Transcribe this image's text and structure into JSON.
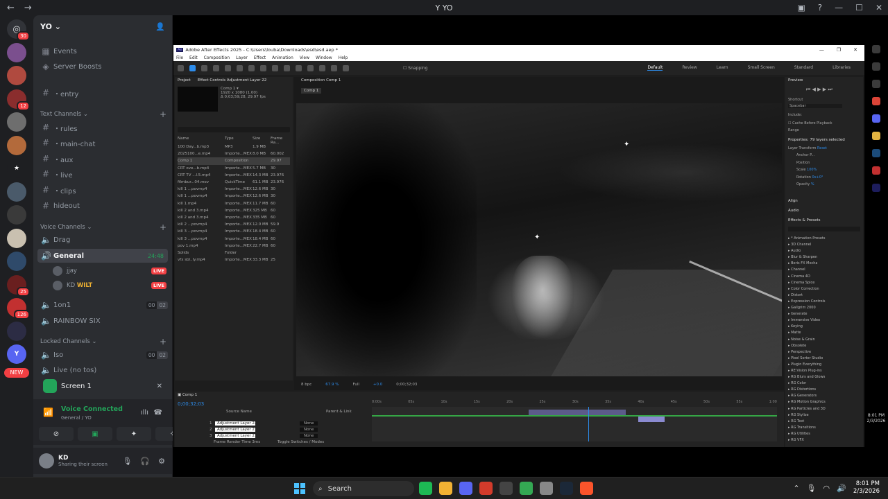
{
  "window": {
    "title": "YO",
    "nav_back": "←",
    "nav_forward": "→",
    "controls": [
      "—",
      "☐",
      "✕"
    ]
  },
  "server_rail": {
    "badges": [
      "30",
      "12",
      "25",
      "126"
    ],
    "server_initial": "Y",
    "new_label": "NEW",
    "home_icon_badge": "30"
  },
  "server": {
    "name": "YO",
    "top_items": [
      {
        "icon": "calendar-icon",
        "label": "Events"
      },
      {
        "icon": "boost-icon",
        "label": "Server Boosts"
      }
    ],
    "entry_channel": "・entry",
    "text_category": "Text Channels",
    "text_channels": [
      "・rules",
      "・main-chat",
      "・aux",
      "・live",
      "・clips",
      "hideout"
    ],
    "voice_category": "Voice Channels",
    "voice_channels": [
      {
        "name": "Drag"
      },
      {
        "name": "General",
        "timer": "24:48",
        "active": true
      },
      {
        "name": "1on1",
        "counts": [
          "00",
          "02"
        ]
      },
      {
        "name": "RAINBOW SIX"
      }
    ],
    "general_members": [
      {
        "name": "jjay",
        "badge": "LIVE"
      },
      {
        "name": "KD",
        "tag": "WILT",
        "badge": "LIVE"
      }
    ],
    "locked_category": "Locked Channels",
    "locked_channels": [
      {
        "name": "Iso",
        "counts": [
          "00",
          "02"
        ]
      },
      {
        "name": "Live (no tos)"
      }
    ]
  },
  "screen_share": {
    "label": "Screen 1"
  },
  "voice_panel": {
    "status": "Voice Connected",
    "location": "General / YO"
  },
  "user_panel": {
    "name": "KD",
    "status": "Sharing their screen"
  },
  "ae": {
    "title": "Adobe After Effects 2025 - C:\\Users\\louba\\Downloads\\esd\\esd.aep *",
    "menu": [
      "File",
      "Edit",
      "Composition",
      "Layer",
      "Effect",
      "Animation",
      "View",
      "Window",
      "Help"
    ],
    "snapping": "Snapping",
    "workspaces": [
      "Default",
      "Review",
      "Learn",
      "Small Screen",
      "Standard",
      "Libraries"
    ],
    "project_tab": "Project",
    "effect_controls_tab": "Effect Controls Adjustment Layer 22",
    "comp_info": [
      "Comp 1 ▾",
      "1920 x 1080 (1.00)",
      "Δ 0;03;59;28, 29.97 fps"
    ],
    "project_headers": [
      "Name",
      "Type",
      "Size",
      "Frame Ra..."
    ],
    "project_rows": [
      [
        "100 Day...b.mp3",
        "MP3",
        "1.9 MB",
        ""
      ],
      [
        "2025100...e.mp4",
        "Importe...MEX",
        "8.0 MB",
        "60.002"
      ],
      [
        "Comp 1",
        "Composition",
        "",
        "29.97"
      ],
      [
        "CRT ove...b.mp4",
        "Importe...MEX",
        "5.7 MB",
        "30"
      ],
      [
        "CRT TV ...l.5.mp4",
        "Importe...MEX",
        "14.3 MB",
        "23.976"
      ],
      [
        "filmbur...04.mov",
        "QuickTime",
        "61.1 MB",
        "23.976"
      ],
      [
        "kill 1 ...povmp4",
        "Importe...MEX",
        "12.6 MB",
        "30"
      ],
      [
        "kill 1 ...povmp4",
        "Importe...MEX",
        "12.6 MB",
        "30"
      ],
      [
        "kill 1.mp4",
        "Importe...MEX",
        "11.7 MB",
        "60"
      ],
      [
        "kill 2 and 3.mp4",
        "Importe...MEX",
        "325 MB",
        "60"
      ],
      [
        "kill 2 and 3.mp4",
        "Importe...MEX",
        "335 MB",
        "60"
      ],
      [
        "kill 2 ...povmp4",
        "Importe...MEX",
        "12.0 MB",
        "59.9"
      ],
      [
        "kill 3 ...povmp4",
        "Importe...MEX",
        "18.4 MB",
        "60"
      ],
      [
        "kill 3 ...povmp4",
        "Importe...MEX",
        "18.4 MB",
        "60"
      ],
      [
        "pov 1.mp4",
        "Importe...MEX",
        "22.7 MB",
        "60"
      ],
      [
        "Solids",
        "Folder",
        "",
        ""
      ],
      [
        "vfx sbl..ly.mp4",
        "Importe...MEX",
        "33.3 MB",
        "25"
      ]
    ],
    "comp_tab": "Composition Comp 1",
    "comp_subtab": "Comp 1",
    "viewer_footer": [
      "67.9 %",
      "Full",
      "+0.0",
      "0;00;32;03",
      "8 bpc"
    ],
    "timeline": {
      "tab": "Comp 1",
      "timecode": "0;00;32;03",
      "columns": [
        "Source Name",
        "Parent & Link"
      ],
      "layers": [
        {
          "idx": "1",
          "name": "Adjustment Layer 22",
          "parent": "None"
        },
        {
          "idx": "2",
          "name": "Adjustment Layer 21",
          "parent": "None"
        },
        {
          "idx": "3",
          "name": "Adjustment Layer 21",
          "parent": "None"
        }
      ],
      "ruler": [
        "0:00s",
        "05s",
        "10s",
        "15s",
        "20s",
        "25s",
        "30s",
        "35s",
        "40s",
        "45s",
        "50s",
        "55s",
        "1:00"
      ],
      "footer": [
        "Frame Render Time 3ms",
        "Toggle Switches / Modes"
      ]
    },
    "right_panel": {
      "preview": "Preview",
      "shortcut_label": "Shortcut",
      "shortcut_value": "Spacebar",
      "include": "Include:",
      "cache": "Cache Before Playback",
      "range": "Range",
      "properties": "Properties: 79 layers selected",
      "layer_transform": "Layer Transform",
      "reset": "Reset",
      "props": [
        "Anchor P...",
        "Position",
        "Scale",
        "Rotation",
        "Opacity"
      ],
      "prop_values": [
        "",
        "",
        "100%",
        "0x+0°",
        "%"
      ],
      "align": "Align",
      "audio": "Audio",
      "effects_presets": "Effects & Presets",
      "effects": [
        "* Animation Presets",
        "3D Channel",
        "Audio",
        "Blur & Sharpen",
        "Boris FX Mocha",
        "Channel",
        "Cinema 4D",
        "Cinema Spice",
        "Color Correction",
        "Distort",
        "Expression Controls",
        "Gallgrim 2000",
        "Generate",
        "Immersive Video",
        "Keying",
        "Matte",
        "Noise & Grain",
        "Obsolete",
        "Perspective",
        "Pixel Sorter Studio",
        "Plugin Everything",
        "RE:Vision Plug-ins",
        "RG Blurs and Glows",
        "RG Color",
        "RG Distortions",
        "RG Generators",
        "RG Motion Graphics",
        "RG Particles and 3D",
        "RG Stylize",
        "RG Text",
        "RG Transitions",
        "RG Utilities",
        "RG VFX"
      ]
    }
  },
  "side_clock": {
    "time": "8:01 PM",
    "date": "2/3/2026"
  },
  "taskbar": {
    "search_placeholder": "Search",
    "time": "8:01 PM",
    "date": "2/3/2026",
    "app_colors": [
      "#1db954",
      "#f2b233",
      "#5865f2",
      "#d23b2b",
      "#444444",
      "#34a853",
      "#888888",
      "#1b2838",
      "#fb542b"
    ]
  }
}
